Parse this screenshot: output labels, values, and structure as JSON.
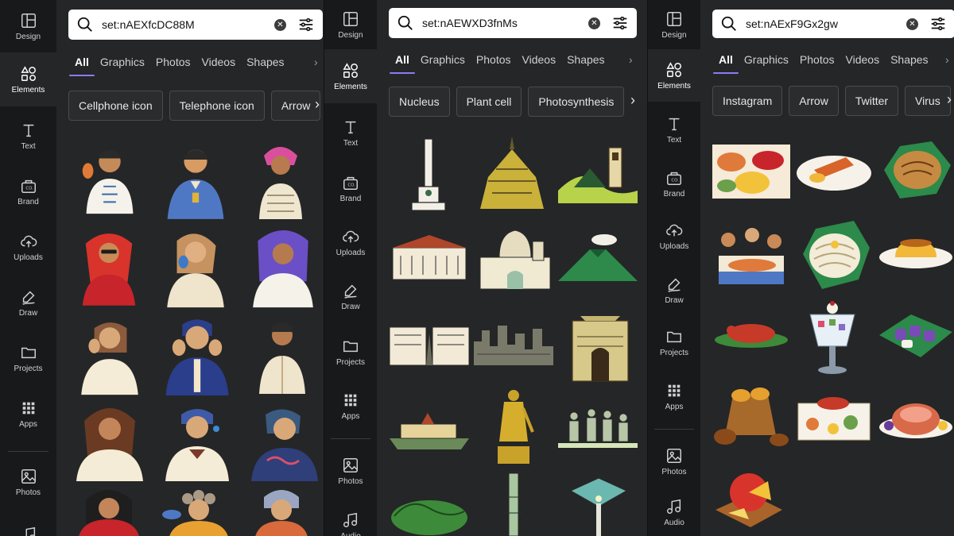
{
  "rail_labels": {
    "design": "Design",
    "elements": "Elements",
    "text": "Text",
    "brand": "Brand",
    "uploads": "Uploads",
    "draw": "Draw",
    "projects": "Projects",
    "apps": "Apps",
    "photos": "Photos",
    "audio": "Audio"
  },
  "tabs": {
    "all": "All",
    "graphics": "Graphics",
    "photos": "Photos",
    "videos": "Videos",
    "shapes": "Shapes"
  },
  "panels": [
    {
      "search_value": "set:nAEXfcDC88M",
      "chips": [
        "Cellphone icon",
        "Telephone icon",
        "Arrow"
      ]
    },
    {
      "search_value": "set:nAEWXD3fnMs",
      "chips": [
        "Nucleus",
        "Plant cell",
        "Photosynthesis"
      ]
    },
    {
      "search_value": "set:nAExF9Gx2gw",
      "chips": [
        "Instagram",
        "Arrow",
        "Twitter",
        "Virus"
      ]
    }
  ],
  "colors": {
    "rail_bg": "#18191b",
    "panel_bg": "#252627",
    "accent": "#8b7cf6"
  },
  "icons": [
    "layout-icon",
    "shapes-icon",
    "text-icon",
    "brand-icon",
    "cloud-upload-icon",
    "pen-icon",
    "folder-icon",
    "grid-icon",
    "image-icon",
    "music-icon",
    "search-icon",
    "clear-icon",
    "filter-icon",
    "chevron-right-icon"
  ]
}
